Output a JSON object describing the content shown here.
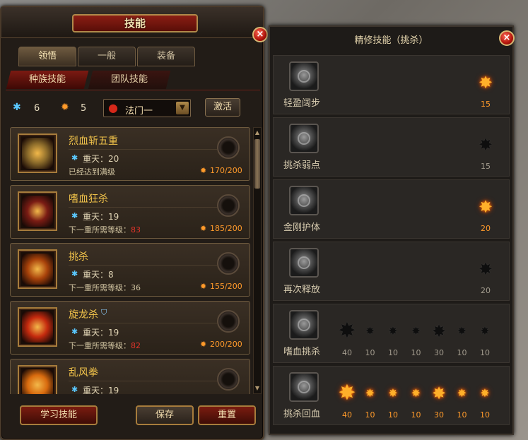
{
  "left_panel": {
    "title": "技能",
    "close_glyph": "×",
    "tabs": [
      {
        "label": "领悟",
        "active": true
      },
      {
        "label": "一般",
        "active": false
      },
      {
        "label": "装备",
        "active": false
      }
    ],
    "subtabs": [
      {
        "label": "种族技能",
        "active": true
      },
      {
        "label": "团队技能",
        "active": false
      }
    ],
    "stats": {
      "blue_gem_count": "6",
      "orange_gem_count": "5"
    },
    "method_select": {
      "value": "法门一"
    },
    "activate_label": "激活",
    "skills": [
      {
        "name": "烈血斩五重",
        "tier_label": "重天：20",
        "req_label": "已经达到满级",
        "req_num": "",
        "progress": "170/200",
        "icon_color": "#8a6a2a"
      },
      {
        "name": "嗜血狂杀",
        "tier_label": "重天：19",
        "req_label": "下一重所需等级：",
        "req_num": "83",
        "progress": "185/200",
        "icon_color": "#7a1c14"
      },
      {
        "name": "挑杀",
        "tier_label": "重天：8",
        "req_label": "下一重所需等级：36",
        "req_num": "",
        "progress": "155/200",
        "icon_color": "#a8420a"
      },
      {
        "name": "旋龙杀",
        "tier_label": "重天：19",
        "req_label": "下一重所需等级：",
        "req_num": "82",
        "progress": "200/200",
        "icon_color": "#c42a0e",
        "shield": true
      },
      {
        "name": "乱风拳",
        "tier_label": "重天：19",
        "req_label": "",
        "req_num": "",
        "progress": "",
        "icon_color": "#d86a0e"
      }
    ],
    "buttons": {
      "learn": "学习技能",
      "save": "保存",
      "reset": "重置"
    }
  },
  "right_panel": {
    "title": "精修技能（挑杀）",
    "close_glyph": "×",
    "rows": [
      {
        "name": "轻盈阔步",
        "stars": [
          {
            "value": "15",
            "lit": true,
            "size": "large"
          }
        ]
      },
      {
        "name": "挑杀弱点",
        "stars": [
          {
            "value": "15",
            "lit": false,
            "size": "large"
          }
        ]
      },
      {
        "name": "金刚护体",
        "stars": [
          {
            "value": "20",
            "lit": true,
            "size": "large"
          }
        ]
      },
      {
        "name": "再次释放",
        "stars": [
          {
            "value": "20",
            "lit": false,
            "size": "large"
          }
        ]
      },
      {
        "name": "嗜血挑杀",
        "stars": [
          {
            "value": "40",
            "lit": false,
            "size": "xl"
          },
          {
            "value": "10",
            "lit": false,
            "size": "small"
          },
          {
            "value": "10",
            "lit": false,
            "size": "small"
          },
          {
            "value": "10",
            "lit": false,
            "size": "small"
          },
          {
            "value": "30",
            "lit": false,
            "size": "large"
          },
          {
            "value": "10",
            "lit": false,
            "size": "small"
          },
          {
            "value": "10",
            "lit": false,
            "size": "small"
          }
        ]
      },
      {
        "name": "挑杀回血",
        "stars": [
          {
            "value": "40",
            "lit": true,
            "size": "xl"
          },
          {
            "value": "10",
            "lit": true,
            "size": "small"
          },
          {
            "value": "10",
            "lit": true,
            "size": "small"
          },
          {
            "value": "10",
            "lit": true,
            "size": "small"
          },
          {
            "value": "30",
            "lit": true,
            "size": "large"
          },
          {
            "value": "10",
            "lit": true,
            "size": "small"
          },
          {
            "value": "10",
            "lit": true,
            "size": "small"
          }
        ]
      }
    ]
  },
  "icons": {
    "blue_gem": "✱",
    "orange_gem": "✹",
    "blood_drop": "●",
    "dropdown_arrow": "▼",
    "star": "✸",
    "shield": "⛉"
  },
  "colors": {
    "accent_red": "#7a1c10",
    "gold_text": "#f0c24a",
    "lit_star": "#ffb02a",
    "blue_gem": "#5ac8ff"
  }
}
